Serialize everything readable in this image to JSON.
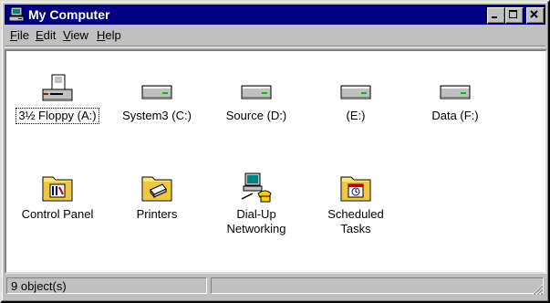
{
  "window": {
    "title": "My Computer",
    "colors": {
      "titlebar": "#000080",
      "face": "#c0c0c0",
      "content_bg": "#ffffff"
    }
  },
  "title_buttons": {
    "minimize_icon": "minimize-icon",
    "maximize_icon": "maximize-icon",
    "close_icon": "close-icon"
  },
  "menu": [
    {
      "accel": "F",
      "rest": "ile"
    },
    {
      "accel": "E",
      "rest": "dit"
    },
    {
      "accel": "V",
      "rest": "iew"
    },
    {
      "accel": "H",
      "rest": "elp"
    }
  ],
  "items": [
    {
      "label": "3½ Floppy (A:)",
      "icon": "floppy-drive-icon",
      "focused": true
    },
    {
      "label": "System3 (C:)",
      "icon": "hard-drive-icon"
    },
    {
      "label": "Source (D:)",
      "icon": "hard-drive-icon"
    },
    {
      "label": "(E:)",
      "icon": "hard-drive-icon"
    },
    {
      "label": "Data (F:)",
      "icon": "hard-drive-icon"
    },
    {
      "label": "Control Panel",
      "icon": "control-panel-folder-icon"
    },
    {
      "label": "Printers",
      "icon": "printers-folder-icon"
    },
    {
      "label": "Dial-Up Networking",
      "icon": "dial-up-networking-icon"
    },
    {
      "label": "Scheduled Tasks",
      "icon": "scheduled-tasks-folder-icon"
    }
  ],
  "status": {
    "object_count": "9 object(s)"
  }
}
